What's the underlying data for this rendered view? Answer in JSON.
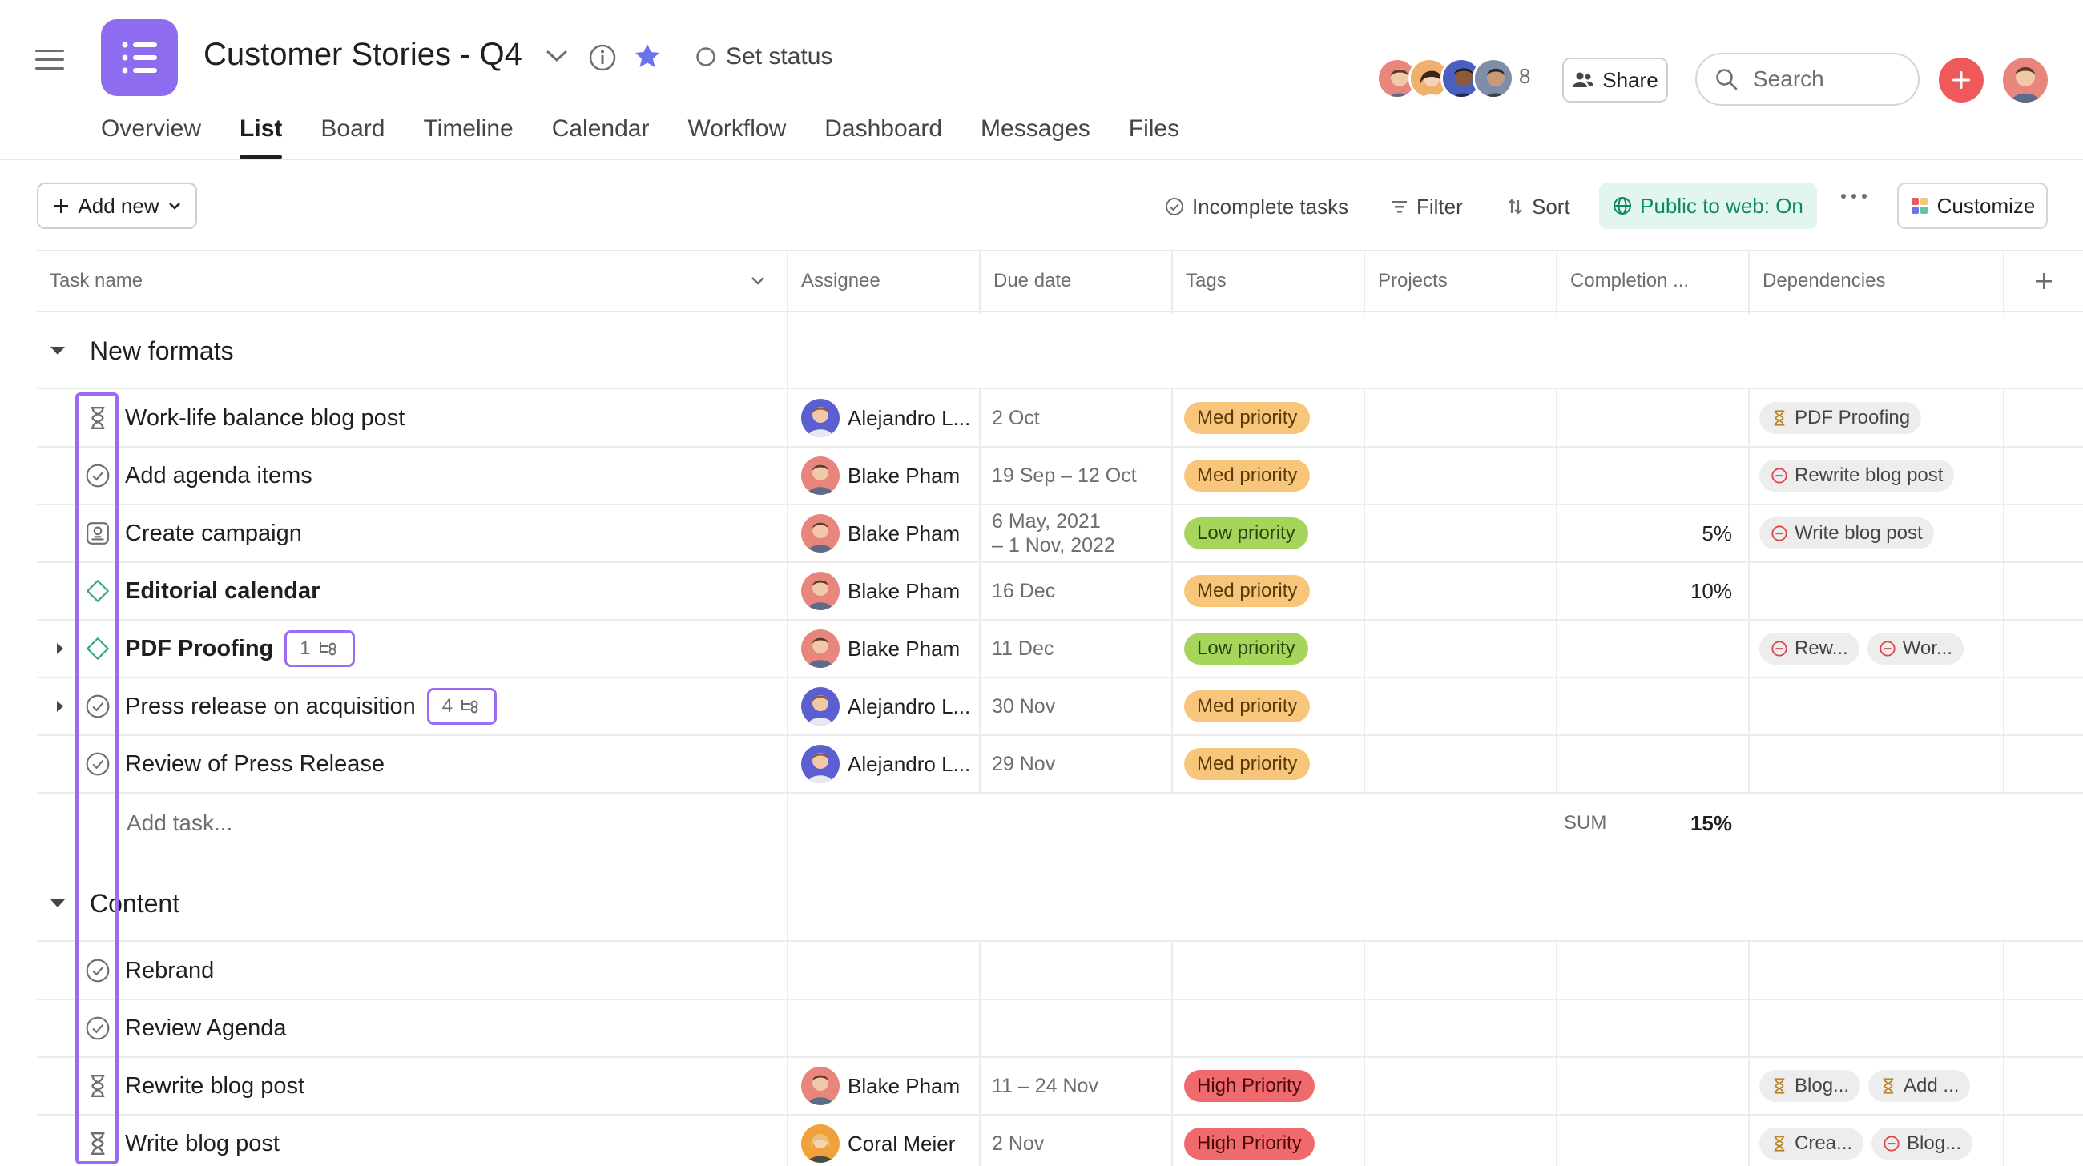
{
  "header": {
    "title": "Customer Stories - Q4",
    "set_status": "Set status",
    "member_count": "8",
    "share": "Share",
    "search_placeholder": "Search"
  },
  "tabs": [
    "Overview",
    "List",
    "Board",
    "Timeline",
    "Calendar",
    "Workflow",
    "Dashboard",
    "Messages",
    "Files"
  ],
  "active_tab": "List",
  "toolbar": {
    "add_new": "Add new",
    "incomplete": "Incomplete tasks",
    "filter": "Filter",
    "sort": "Sort",
    "public": "Public to web: On",
    "customize": "Customize"
  },
  "columns": {
    "task_name": "Task name",
    "assignee": "Assignee",
    "due_date": "Due date",
    "tags": "Tags",
    "projects": "Projects",
    "completion": "Completion ...",
    "dependencies": "Dependencies"
  },
  "colors": {
    "accent": "#8d6cf0",
    "highlight": "#9a6cf4",
    "med_priority": "#f8c67a",
    "low_priority": "#a5d65b",
    "high_priority": "#ef6a6c",
    "public_green": "#0e8a5f"
  },
  "sections": [
    {
      "name": "New formats",
      "tasks": [
        {
          "icon": "hourglass-icon",
          "name": "Work-life balance blog post",
          "bold": false,
          "assignee": "Alejandro L...",
          "avatar": "alejandro",
          "due": "2 Oct",
          "tag": "Med priority",
          "tag_kind": "med",
          "completion": "",
          "deps": [
            {
              "icon": "hourglass-icon",
              "label": "PDF Proofing"
            }
          ]
        },
        {
          "icon": "check-circle-icon",
          "name": "Add agenda items",
          "bold": false,
          "assignee": "Blake Pham",
          "avatar": "blake",
          "due": "19 Sep – 12 Oct",
          "tag": "Med priority",
          "tag_kind": "med",
          "completion": "",
          "deps": [
            {
              "icon": "blocked-icon",
              "label": "Rewrite blog post"
            }
          ]
        },
        {
          "icon": "approval-icon",
          "name": "Create campaign",
          "bold": false,
          "assignee": "Blake Pham",
          "avatar": "blake",
          "due": "6 May, 2021",
          "due2": "– 1 Nov, 2022",
          "tag": "Low priority",
          "tag_kind": "low",
          "completion": "5%",
          "deps": [
            {
              "icon": "blocked-icon",
              "label": "Write blog post"
            }
          ]
        },
        {
          "icon": "milestone-icon",
          "name": "Editorial calendar",
          "bold": true,
          "assignee": "Blake Pham",
          "avatar": "blake",
          "due": "16 Dec",
          "tag": "Med priority",
          "tag_kind": "med",
          "completion": "10%",
          "deps": []
        },
        {
          "icon": "milestone-icon",
          "name": "PDF Proofing",
          "bold": true,
          "expand": true,
          "subtasks": "1",
          "assignee": "Blake Pham",
          "avatar": "blake",
          "due": "11 Dec",
          "tag": "Low priority",
          "tag_kind": "low",
          "completion": "",
          "deps": [
            {
              "icon": "blocked-icon",
              "label": "Rew..."
            },
            {
              "icon": "blocked-icon",
              "label": "Wor..."
            }
          ]
        },
        {
          "icon": "check-circle-icon",
          "name": "Press release on acquisition",
          "bold": false,
          "expand": true,
          "subtasks": "4",
          "assignee": "Alejandro L...",
          "avatar": "alejandro",
          "due": "30 Nov",
          "tag": "Med priority",
          "tag_kind": "med",
          "completion": "",
          "deps": []
        },
        {
          "icon": "check-circle-icon",
          "name": "Review of Press Release",
          "bold": false,
          "assignee": "Alejandro L...",
          "avatar": "alejandro",
          "due": "29 Nov",
          "tag": "Med priority",
          "tag_kind": "med",
          "completion": "",
          "deps": []
        }
      ],
      "add_task": "Add task...",
      "sum_label": "SUM",
      "sum_value": "15%"
    },
    {
      "name": "Content",
      "tasks": [
        {
          "icon": "check-circle-icon",
          "name": "Rebrand",
          "bold": false,
          "assignee": "",
          "avatar": "",
          "due": "",
          "tag": "",
          "tag_kind": "",
          "completion": "",
          "deps": []
        },
        {
          "icon": "check-circle-icon",
          "name": "Review Agenda",
          "bold": false,
          "assignee": "",
          "avatar": "",
          "due": "",
          "tag": "",
          "tag_kind": "",
          "completion": "",
          "deps": []
        },
        {
          "icon": "hourglass-icon",
          "name": "Rewrite blog post",
          "bold": false,
          "assignee": "Blake Pham",
          "avatar": "blake",
          "due": "11 – 24 Nov",
          "tag": "High Priority",
          "tag_kind": "high",
          "completion": "",
          "deps": [
            {
              "icon": "hourglass-icon",
              "label": "Blog..."
            },
            {
              "icon": "hourglass-icon",
              "label": "Add ..."
            }
          ]
        },
        {
          "icon": "hourglass-icon",
          "name": "Write blog post",
          "bold": false,
          "assignee": "Coral Meier",
          "avatar": "coral",
          "due": "2 Nov",
          "tag": "High Priority",
          "tag_kind": "high",
          "completion": "",
          "deps": [
            {
              "icon": "hourglass-icon",
              "label": "Crea..."
            },
            {
              "icon": "blocked-icon",
              "label": "Blog..."
            }
          ]
        }
      ]
    }
  ]
}
